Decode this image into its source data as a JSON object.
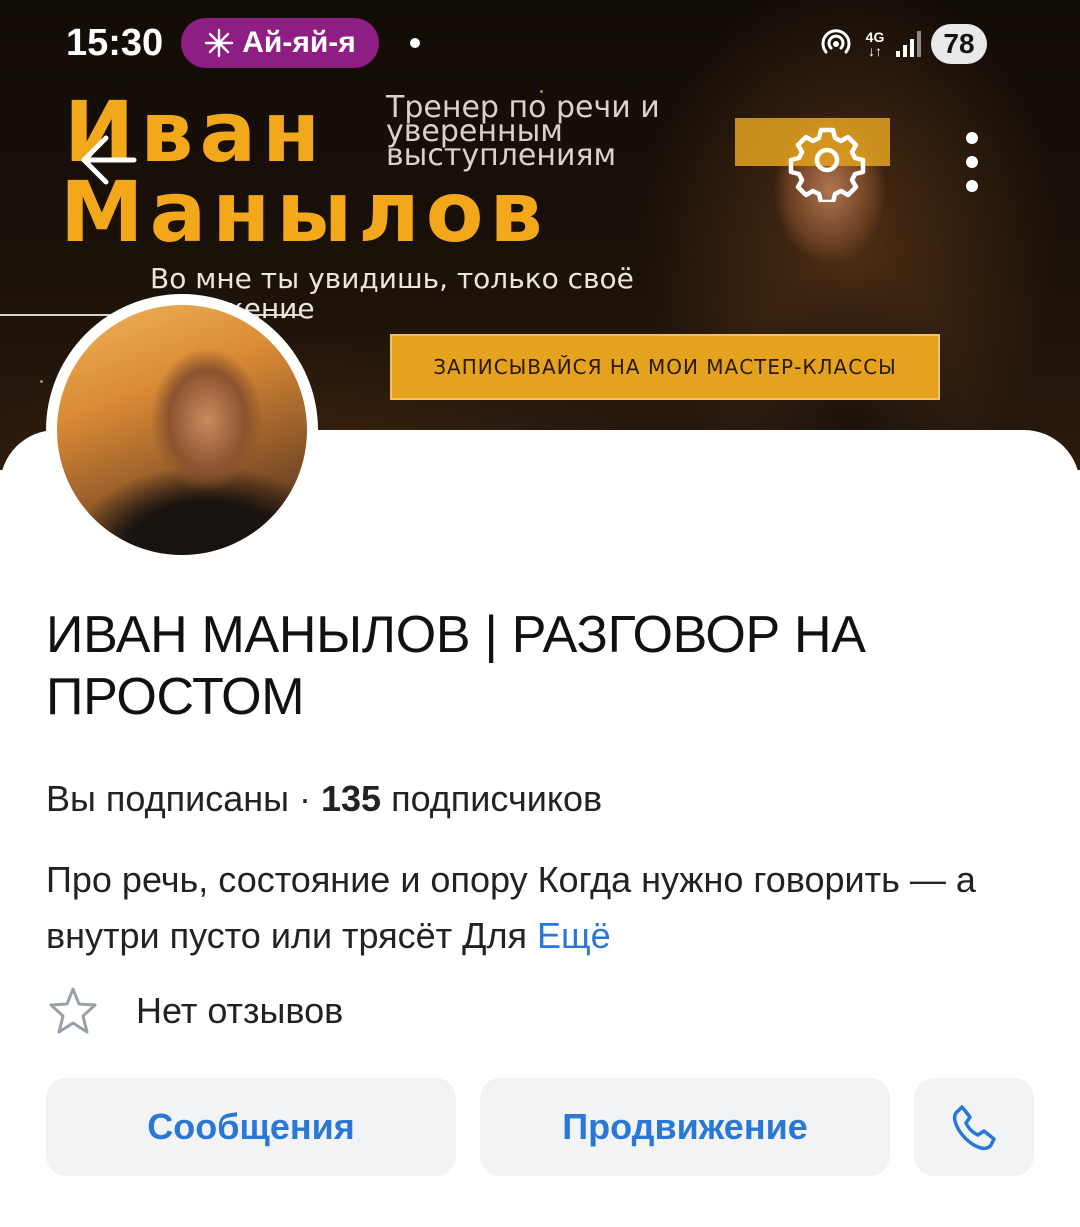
{
  "status_bar": {
    "time": "15:30",
    "notification_pill": "Ай-яй-я",
    "network": "4G",
    "battery": "78"
  },
  "cover": {
    "name_line1": "Иван",
    "name_line2": "Манылов",
    "subtitle": "Тренер по речи и уверенным выступлениям",
    "tagline": "Во мне ты увидишь, только своё отражение",
    "cta": "ЗАПИСЫВАЙСЯ НА МОИ МАСТЕР-КЛАССЫ",
    "accent_color": "#f3a81c"
  },
  "profile": {
    "title": "ИВАН МАНЫЛОВ | РАЗГОВОР НА ПРОСТОМ",
    "subscription_status": "Вы подписаны",
    "separator": " · ",
    "subscriber_count": "135",
    "subscriber_label": " подписчиков",
    "description": "Про речь, состояние и опору Когда нужно говорить — а внутри пусто или трясёт Для ",
    "more_link": "Ещё",
    "reviews": "Нет отзывов"
  },
  "actions": {
    "messages": "Сообщения",
    "promotion": "Продвижение",
    "call_icon": "phone-icon"
  },
  "colors": {
    "link": "#2a78d6",
    "pill": "#8e1d84",
    "button_bg": "#f2f3f5"
  }
}
